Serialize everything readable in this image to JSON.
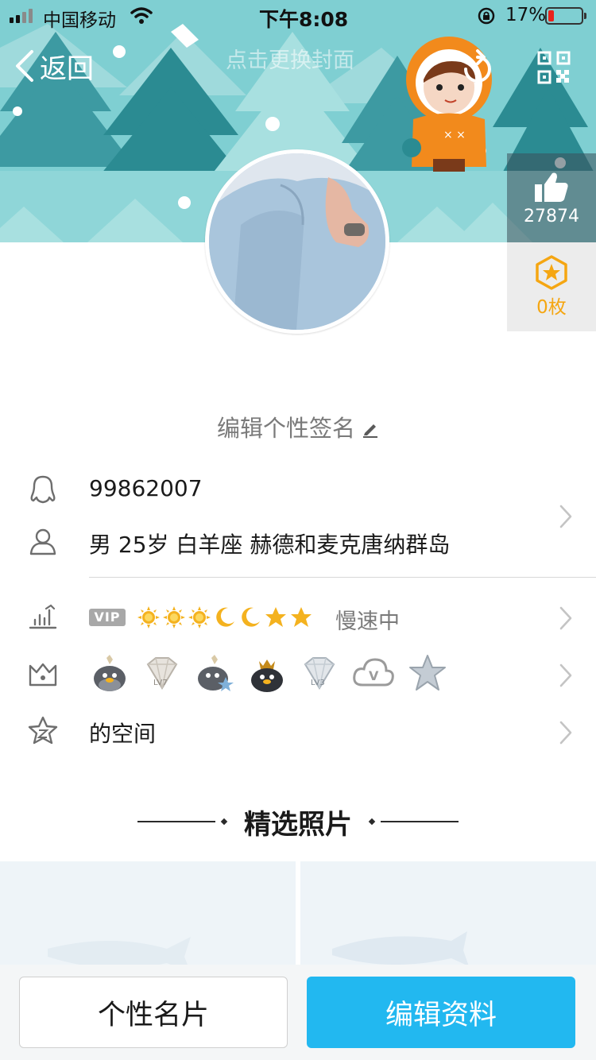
{
  "status_bar": {
    "carrier": "中国移动",
    "time": "下午8:08",
    "battery_percent": "17%",
    "battery_level": 0.17
  },
  "header": {
    "back_label": "返回",
    "cover_hint": "点击更换封面"
  },
  "stats": {
    "likes": "27874",
    "coins": "0枚",
    "accent_color": "#f5a612"
  },
  "profile": {
    "signature": "编辑个性签名",
    "qq_number": "99862007",
    "details": "男 25岁 白羊座 赫德和麦克唐纳群岛",
    "speed_status": "慢速中",
    "space_label": "的空间",
    "vip_label": "VIP",
    "level_icons": [
      "sun",
      "sun",
      "sun",
      "moon",
      "moon",
      "star",
      "star"
    ]
  },
  "badges": {
    "lv7_label": "LV7",
    "lv3_label": "LV3",
    "v_label": "V"
  },
  "section": {
    "featured_title": "精选照片"
  },
  "bottom": {
    "card_button": "个性名片",
    "edit_button": "编辑资料",
    "edit_color": "#22b8f0"
  }
}
